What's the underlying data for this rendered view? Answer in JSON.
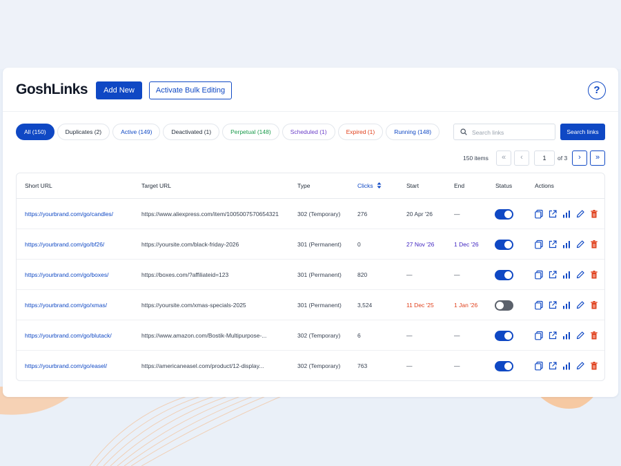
{
  "app": {
    "name": "GoshLinks"
  },
  "toolbar": {
    "add_new": "Add New",
    "bulk_edit": "Activate Bulk Editing",
    "help": "?"
  },
  "filters": [
    {
      "label": "All (150)",
      "color": "#ffffff",
      "active": true
    },
    {
      "label": "Duplicates (2)",
      "color": "#1f2937"
    },
    {
      "label": "Active (149)",
      "color": "#0f48c4"
    },
    {
      "label": "Deactivated (1)",
      "color": "#1f2937"
    },
    {
      "label": "Perpetual (148)",
      "color": "#1a9a4b"
    },
    {
      "label": "Scheduled (1)",
      "color": "#6b3fc9"
    },
    {
      "label": "Expired (1)",
      "color": "#e0401c"
    },
    {
      "label": "Running (148)",
      "color": "#0f48c4"
    }
  ],
  "search": {
    "placeholder": "Search links",
    "value": "",
    "button": "Search links"
  },
  "pagination": {
    "items": "150 items",
    "first": "«",
    "prev": "‹",
    "page": "1",
    "of": "of 3",
    "next": "›",
    "last": "»"
  },
  "table": {
    "headers": {
      "short_url": "Short URL",
      "target_url": "Target URL",
      "type": "Type",
      "clicks": "Clicks",
      "start": "Start",
      "end": "End",
      "status": "Status",
      "actions": "Actions"
    },
    "rows": [
      {
        "short_url": "https://yourbrand.com/go/candles/",
        "target_url": "https://www.aliexpress.com/item/1005007570654321",
        "type": "302 (Temporary)",
        "clicks": "276",
        "start": "20 Apr '26",
        "start_color": "#374151",
        "end": "—",
        "end_color": "#374151",
        "status": true
      },
      {
        "short_url": "https://yourbrand.com/go/bf26/",
        "target_url": "https://yoursite.com/black-friday-2026",
        "type": "301 (Permanent)",
        "clicks": "0",
        "start": "27 Nov '26",
        "start_color": "#3b1fbf",
        "end": "1 Dec '26",
        "end_color": "#3b1fbf",
        "status": true
      },
      {
        "short_url": "https://yourbrand.com/go/boxes/",
        "target_url": "https://boxes.com/?affiliateid=123",
        "type": "301 (Permanent)",
        "clicks": "820",
        "start": "—",
        "start_color": "#374151",
        "end": "—",
        "end_color": "#374151",
        "status": true
      },
      {
        "short_url": "https://yourbrand.com/go/xmas/",
        "target_url": "https://yoursite.com/xmas-specials-2025",
        "type": "301 (Permanent)",
        "clicks": "3,524",
        "start": "11 Dec '25",
        "start_color": "#e0401c",
        "end": "1 Jan '26",
        "end_color": "#e0401c",
        "status": false
      },
      {
        "short_url": "https://yourbrand.com/go/blutack/",
        "target_url": "https://www.amazon.com/Bostik-Multipurpose-...",
        "type": "302 (Temporary)",
        "clicks": "6",
        "start": "—",
        "start_color": "#374151",
        "end": "—",
        "end_color": "#374151",
        "status": true
      },
      {
        "short_url": "https://yourbrand.com/go/easel/",
        "target_url": "https://americaneasel.com/product/12-display...",
        "type": "302 (Temporary)",
        "clicks": "763",
        "start": "—",
        "start_color": "#374151",
        "end": "—",
        "end_color": "#374151",
        "status": true
      }
    ],
    "action_icons": [
      "copy-icon",
      "external-link-icon",
      "stats-icon",
      "edit-icon",
      "delete-icon"
    ]
  },
  "colors": {
    "accent": "#0f48c4",
    "danger": "#e0401c",
    "toggle_off": "#5b616b"
  }
}
